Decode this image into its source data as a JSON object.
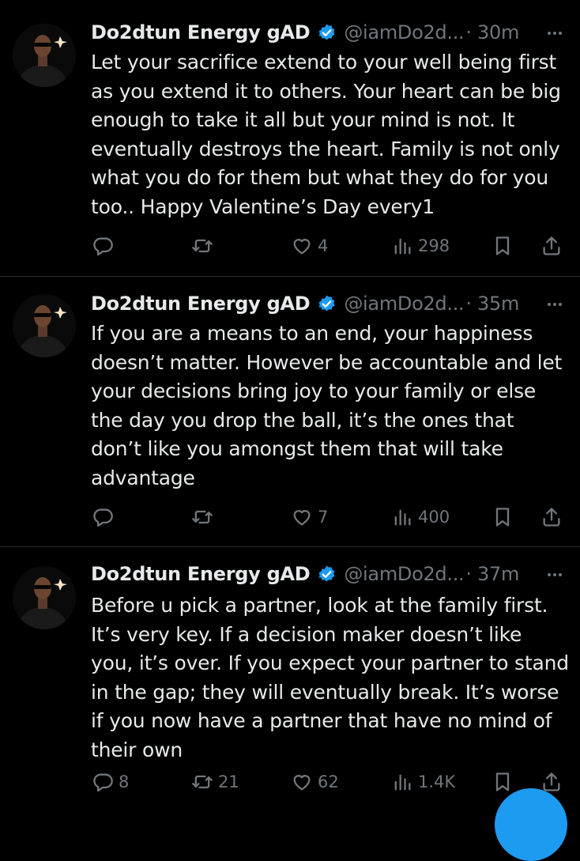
{
  "colors": {
    "background": "#000000",
    "text": "#e7e9ea",
    "muted": "#71767b",
    "divider": "#2f3336",
    "verified": "#1d9bf0",
    "fab": "#1d9bf0"
  },
  "tweets": [
    {
      "author_name": "Do2dtun Energy gAD",
      "handle": "@iamDo2d...",
      "time": "· 30m",
      "text": "Let your sacrifice extend to your well being first as you extend it to others. Your heart can be big enough to take it all but your mind is not. It eventually destroys the heart. Family is not only what you do for them but what they do for you too.. Happy Valentine’s Day every1",
      "replies": "",
      "reposts": "",
      "likes": "4",
      "views": "298"
    },
    {
      "author_name": "Do2dtun Energy gAD",
      "handle": "@iamDo2d...",
      "time": "· 35m",
      "text": "If you are a means to an end, your happiness doesn’t matter. However be accountable and let your decisions bring joy to your family or else the day you drop the ball, it’s the ones that don’t like you amongst them that will take advantage",
      "replies": "",
      "reposts": "",
      "likes": "7",
      "views": "400"
    },
    {
      "author_name": "Do2dtun Energy gAD",
      "handle": "@iamDo2d...",
      "time": "· 37m",
      "text": "Before u pick a partner, look at the family first. It’s very key. If a decision maker doesn’t like you, it’s over. If you expect your partner to stand in the gap; they will eventually break. It’s worse if you now have a partner that have no mind of their own",
      "replies": "8",
      "reposts": "21",
      "likes": "62",
      "views": "1.4K"
    }
  ],
  "icons": {
    "verified": "verified-badge-icon",
    "more": "more-options-icon",
    "reply": "reply-icon",
    "repost": "repost-icon",
    "like": "heart-icon",
    "views": "views-chart-icon",
    "bookmark": "bookmark-icon",
    "share": "share-icon",
    "compose": "compose-button"
  }
}
